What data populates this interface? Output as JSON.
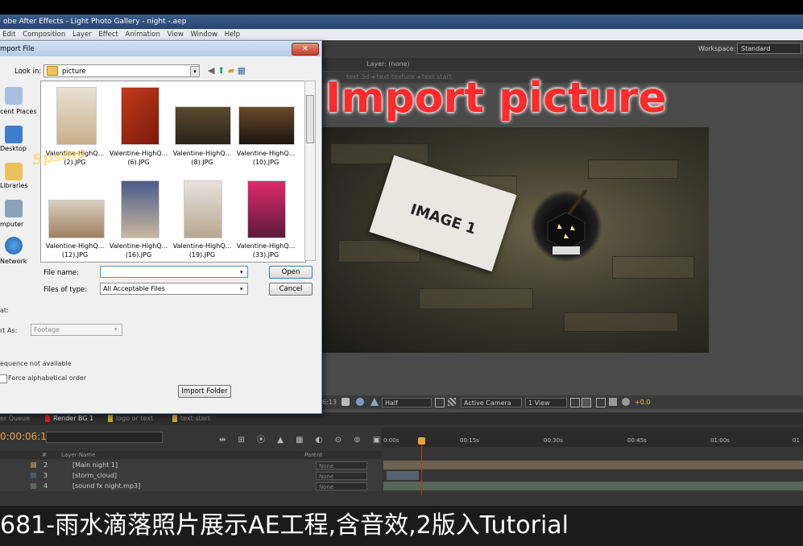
{
  "window": {
    "title": "obe After Effects - Light Photo Gallery - night -.aep"
  },
  "menu": [
    "Edit",
    "Composition",
    "Layer",
    "Effect",
    "Animation",
    "View",
    "Window",
    "Help"
  ],
  "workspace": {
    "label": "Workspace:",
    "value": "Standard"
  },
  "comp_panel": {
    "layer_tab": "Layer: (none)",
    "crumbs": "text 3d  ◂  text texture  ◂  text start",
    "overlay_title": "Import picture",
    "card_text": "IMAGE 1"
  },
  "comp_footer": {
    "time": "6:13",
    "resolution": "Half",
    "camera": "Active Camera",
    "view": "1 View",
    "offset": "+0.0"
  },
  "panel_tabs": [
    "er Queue",
    "Render BG 1",
    "logo or text",
    "text start"
  ],
  "timeline": {
    "current_time": "0:00:06:13",
    "ruler_labels": [
      "0:00s",
      "00:15s",
      "00:30s",
      "00:45s",
      "01:00s",
      "01"
    ],
    "columns": {
      "hash": "#",
      "layer_name": "Layer Name",
      "parent": "Parent"
    },
    "layers": [
      {
        "num": "2",
        "name": "[Main night 1]",
        "parent": "None",
        "color": "#8a7a58"
      },
      {
        "num": "3",
        "name": "[storm_cloud]",
        "parent": "None",
        "color": "#4c5a6a"
      },
      {
        "num": "4",
        "name": "[sound fx night.mp3]",
        "parent": "None",
        "color": "#5c6a5a"
      }
    ]
  },
  "caption": "681-雨水滴落照片展示AE工程,含音效,2版入Tutorial",
  "dialog": {
    "title": "mport File",
    "look_in_label": "Look in:",
    "look_in_value": "picture",
    "places": [
      "cent Places",
      "Desktop",
      "Libraries",
      "mputer",
      "Network"
    ],
    "files": [
      {
        "line1": "Valentine-HighQ...",
        "line2": "(2).JPG"
      },
      {
        "line1": "Valentine-HighQ...",
        "line2": "(6).JPG"
      },
      {
        "line1": "Valentine-HighQ...",
        "line2": "(8).JPG"
      },
      {
        "line1": "Valentine-HighQ...",
        "line2": "(10).JPG"
      },
      {
        "line1": "Valentine-HighQ...",
        "line2": "(12).JPG"
      },
      {
        "line1": "Valentine-HighQ...",
        "line2": "(16).JPG"
      },
      {
        "line1": "Valentine-HighQ...",
        "line2": "(19).JPG"
      },
      {
        "line1": "Valentine-HighQ...",
        "line2": "(33).JPG"
      }
    ],
    "file_name_label": "File name:",
    "file_name_value": "",
    "files_of_type_label": "Files of type:",
    "files_of_type_value": "All Acceptable Files",
    "open_button": "Open",
    "cancel_button": "Cancel",
    "format_label": "at:",
    "import_as_label": "rt As:",
    "import_as_value": "Footage",
    "sequence_text": "equence not available",
    "force_alpha": "Force alphabetical order",
    "import_folder_button": "Import Folder",
    "watermark": "Spsms"
  },
  "colors": {
    "accent_red": "#ff2a2a",
    "time_orange": "#e8a33a",
    "title_blue": "#27466f"
  }
}
